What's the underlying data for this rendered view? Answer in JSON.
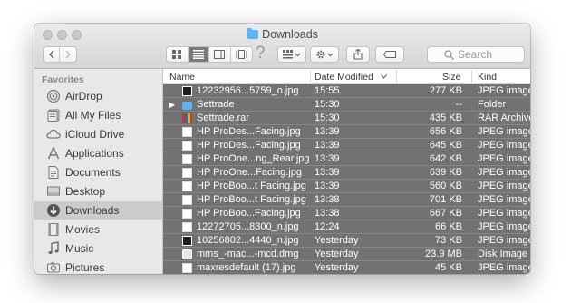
{
  "window": {
    "title": "Downloads"
  },
  "toolbar": {
    "view_modes": [
      "icon-view",
      "list-view",
      "column-view",
      "cover-flow-view"
    ],
    "active_view": "list-view",
    "search_placeholder": "Search"
  },
  "sidebar": {
    "heading": "Favorites",
    "items": [
      {
        "label": "AirDrop",
        "icon": "airdrop-icon"
      },
      {
        "label": "All My Files",
        "icon": "all-files-icon"
      },
      {
        "label": "iCloud Drive",
        "icon": "cloud-icon"
      },
      {
        "label": "Applications",
        "icon": "applications-icon"
      },
      {
        "label": "Documents",
        "icon": "documents-icon"
      },
      {
        "label": "Desktop",
        "icon": "desktop-icon"
      },
      {
        "label": "Downloads",
        "icon": "downloads-icon",
        "selected": true
      },
      {
        "label": "Movies",
        "icon": "movies-icon"
      },
      {
        "label": "Music",
        "icon": "music-icon"
      },
      {
        "label": "Pictures",
        "icon": "pictures-icon"
      }
    ]
  },
  "columns": {
    "name": "Name",
    "date": "Date Modified",
    "size": "Size",
    "kind": "Kind"
  },
  "files": [
    {
      "name": "12232956...5759_o.jpg",
      "date": "15:55",
      "size": "277 KB",
      "kind": "JPEG image",
      "icon": "dark"
    },
    {
      "name": "Settrade",
      "date": "15:30",
      "size": "--",
      "kind": "Folder",
      "icon": "folder",
      "disclosure": "▶"
    },
    {
      "name": "Settrade.rar",
      "date": "15:30",
      "size": "435 KB",
      "kind": "RAR Archive",
      "icon": "rar"
    },
    {
      "name": "HP ProDes...Facing.jpg",
      "date": "13:39",
      "size": "656 KB",
      "kind": "JPEG image",
      "icon": "img"
    },
    {
      "name": "HP ProDes...Facing.jpg",
      "date": "13:39",
      "size": "645 KB",
      "kind": "JPEG image",
      "icon": "img"
    },
    {
      "name": "HP ProOne...ng_Rear.jpg",
      "date": "13:39",
      "size": "642 KB",
      "kind": "JPEG image",
      "icon": "img"
    },
    {
      "name": "HP ProOne...Facing.jpg",
      "date": "13:39",
      "size": "639 KB",
      "kind": "JPEG image",
      "icon": "img"
    },
    {
      "name": "HP ProBoo...t Facing.jpg",
      "date": "13:39",
      "size": "560 KB",
      "kind": "JPEG image",
      "icon": "img"
    },
    {
      "name": "HP ProBoo...t Facing.jpg",
      "date": "13:38",
      "size": "701 KB",
      "kind": "JPEG image",
      "icon": "img"
    },
    {
      "name": "HP ProBoo...Facing.jpg",
      "date": "13:38",
      "size": "667 KB",
      "kind": "JPEG image",
      "icon": "img"
    },
    {
      "name": "12272705...8300_n.jpg",
      "date": "12:24",
      "size": "66 KB",
      "kind": "JPEG image",
      "icon": "img"
    },
    {
      "name": "10256802...4440_n.jpg",
      "date": "Yesterday",
      "size": "73 KB",
      "kind": "JPEG image",
      "icon": "dark"
    },
    {
      "name": "mms_-mac...-mcd.dmg",
      "date": "Yesterday",
      "size": "23.9 MB",
      "kind": "Disk Image",
      "icon": "dmg"
    },
    {
      "name": "maxresdefault (17).jpg",
      "date": "Yesterday",
      "size": "45 KB",
      "kind": "JPEG image",
      "icon": "img"
    }
  ]
}
